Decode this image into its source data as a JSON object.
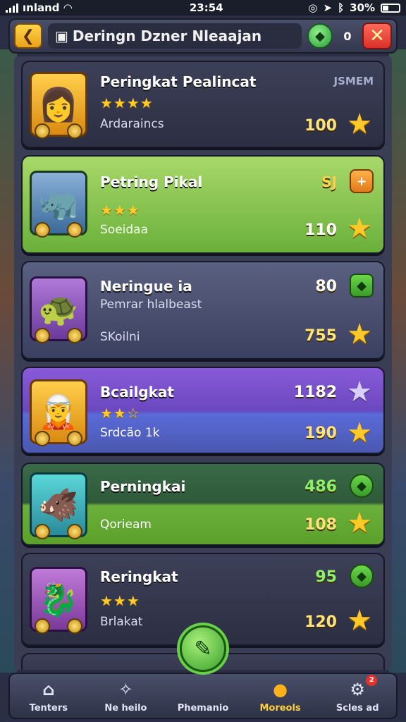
{
  "status_bar": {
    "carrier": "ınland",
    "time": "23:54",
    "battery": "30%"
  },
  "header": {
    "back_icon": "chevron-left-icon",
    "title": "Deringn Dzner Nleaajan",
    "gem_count": "0",
    "close_icon": "close-icon"
  },
  "rows": [
    {
      "name": "Peringkat Pealincat",
      "stars": "★★★★",
      "sub": "Ardaraincs",
      "tag": "JSMEM",
      "score": "100",
      "theme": "dark"
    },
    {
      "name": "Petring Pikal",
      "stars": "★★★",
      "sub": "Soeidaa",
      "score_top": "SJ",
      "score": "110",
      "theme": "green"
    },
    {
      "name": "Neringue ia",
      "sub_top": "Pemrar hlalbeast",
      "sub": "SKoilni",
      "score_top": "80",
      "score": "755",
      "theme": "slate"
    },
    {
      "name": "Bcailgkat",
      "stars": "★★☆",
      "sub": "Srdcäo 1k",
      "score_top": "1182",
      "score": "190",
      "theme": "purple"
    },
    {
      "name": "Perningkai",
      "sub": "Qorieam",
      "score_top": "486",
      "score": "108",
      "theme": "darkgreen"
    },
    {
      "name": "Reringkat",
      "stars": "★★★",
      "sub": "Brlakat",
      "score_top": "95",
      "score": "120",
      "theme": "dark"
    }
  ],
  "bottom_nav": [
    {
      "label": "Tenters",
      "icon": "home-icon"
    },
    {
      "label": "Ne heilo",
      "icon": "compass-icon"
    },
    {
      "label": "Phemanio",
      "icon": "play-icon"
    },
    {
      "label": "Moreols",
      "icon": "coin-icon"
    },
    {
      "label": "Scles ad",
      "icon": "gear-icon",
      "badge": "2"
    }
  ],
  "colors": {
    "accent_gold": "#ffc928",
    "close_red": "#d8302a",
    "gem_green": "#2c9a3a"
  }
}
